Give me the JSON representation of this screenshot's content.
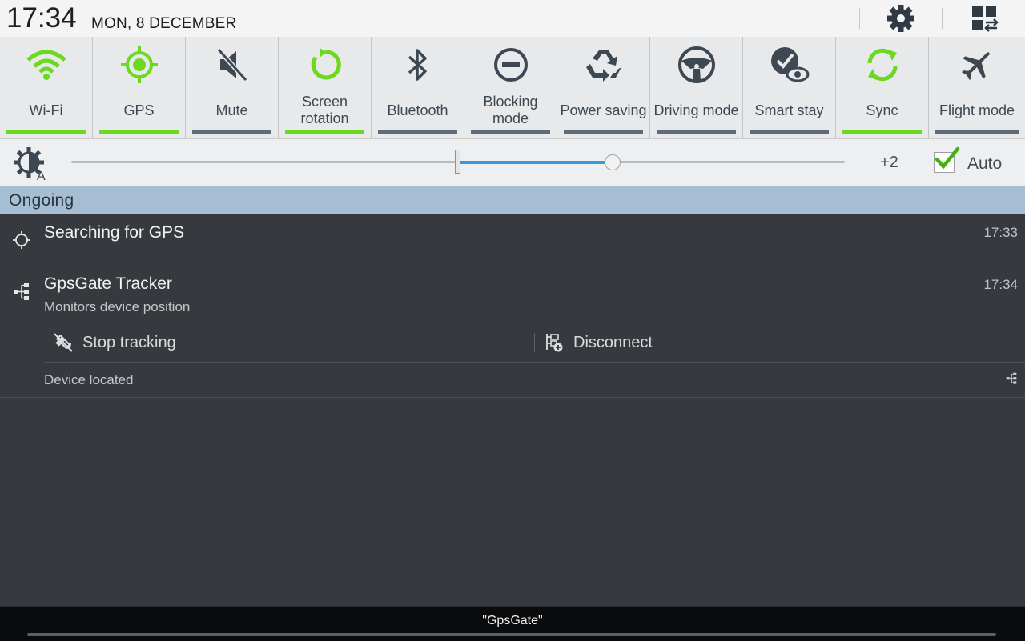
{
  "header": {
    "time": "17:34",
    "date": "MON, 8 DECEMBER",
    "settings_icon": "gear-icon",
    "multiwindow_icon": "grid-arrows-icon"
  },
  "toggles": [
    {
      "label": "Wi-Fi",
      "icon": "wifi-icon",
      "active": true
    },
    {
      "label": "GPS",
      "icon": "gps-icon",
      "active": true
    },
    {
      "label": "Mute",
      "icon": "mute-icon",
      "active": false
    },
    {
      "label": "Screen rotation",
      "icon": "rotation-icon",
      "active": true
    },
    {
      "label": "Bluetooth",
      "icon": "bluetooth-icon",
      "active": false
    },
    {
      "label": "Blocking mode",
      "icon": "blocking-icon",
      "active": false
    },
    {
      "label": "Power saving",
      "icon": "recycle-icon",
      "active": false
    },
    {
      "label": "Driving mode",
      "icon": "steering-wheel-icon",
      "active": false
    },
    {
      "label": "Smart stay",
      "icon": "smart-stay-icon",
      "active": false
    },
    {
      "label": "Sync",
      "icon": "sync-icon",
      "active": true
    },
    {
      "label": "Flight mode",
      "icon": "airplane-icon",
      "active": false
    }
  ],
  "brightness": {
    "icon": "brightness-auto-icon",
    "level": "+2",
    "value_fraction": 0.7,
    "default_fraction": 0.5,
    "auto_label": "Auto",
    "auto_checked": true
  },
  "section": {
    "title": "Ongoing"
  },
  "notifications": [
    {
      "title": "Searching for GPS",
      "time": "17:33",
      "icon": "crosshair-icon"
    },
    {
      "title": "GpsGate Tracker",
      "subtitle": "Monitors device position",
      "time": "17:34",
      "icon": "tree-icon",
      "actions": [
        {
          "label": "Stop tracking",
          "icon": "satellite-off-icon"
        },
        {
          "label": "Disconnect",
          "icon": "disconnect-icon"
        }
      ],
      "footer": "Device located"
    }
  ],
  "bottom": {
    "title": "\"GpsGate\""
  },
  "colors": {
    "active_bar": "#6cd81e",
    "inactive_bar": "#5d6c7a",
    "slider_fill": "#3a9ad8",
    "section_bg": "#a6bed4"
  }
}
